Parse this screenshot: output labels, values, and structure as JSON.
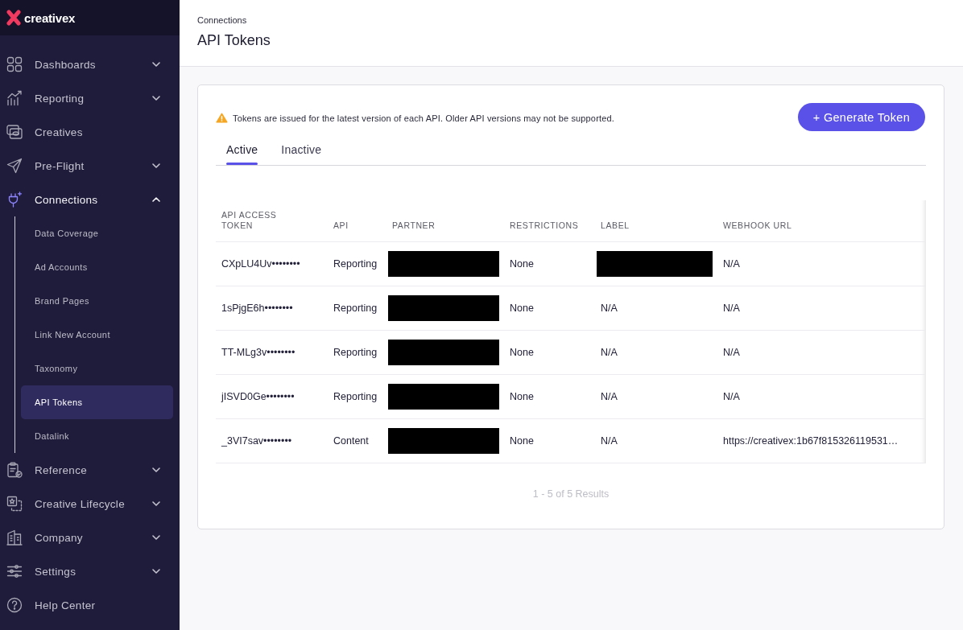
{
  "sidebar": {
    "logo": "creativex",
    "items": [
      {
        "label": "Dashboards",
        "selected": false,
        "expanded": false
      },
      {
        "label": "Reporting",
        "selected": false,
        "expanded": false
      },
      {
        "label": "Creatives",
        "selected": false
      },
      {
        "label": "Pre-Flight",
        "selected": false,
        "expanded": false
      },
      {
        "label": "Connections",
        "selected": true,
        "expanded": true,
        "children": [
          {
            "label": "Data Coverage",
            "selected": false
          },
          {
            "label": "Ad Accounts",
            "selected": false
          },
          {
            "label": "Brand Pages",
            "selected": false
          },
          {
            "label": "Link New Account",
            "selected": false
          },
          {
            "label": "Taxonomy",
            "selected": false
          },
          {
            "label": "API Tokens",
            "selected": true
          },
          {
            "label": "Datalink",
            "selected": false
          }
        ]
      },
      {
        "label": "Reference",
        "selected": false,
        "expanded": false
      },
      {
        "label": "Creative Lifecycle",
        "selected": false,
        "expanded": false
      },
      {
        "label": "Company",
        "selected": false,
        "expanded": false
      },
      {
        "label": "Settings",
        "selected": false,
        "expanded": false
      },
      {
        "label": "Help Center",
        "selected": false
      }
    ]
  },
  "header": {
    "breadcrumb": "Connections",
    "title": "API Tokens"
  },
  "notice": "Tokens are issued for the latest version of each API. Older API versions may not be supported.",
  "generate_button": "+ Generate Token",
  "tabs": [
    {
      "label": "Active",
      "selected": true
    },
    {
      "label": "Inactive",
      "selected": false
    }
  ],
  "table": {
    "columns": [
      "API ACCESS TOKEN",
      "API",
      "PARTNER",
      "RESTRICTIONS",
      "LABEL",
      "WEBHOOK URL"
    ],
    "rows": [
      {
        "cells": [
          {
            "kind": "text",
            "text": "CXpLU4Uv••••••••"
          },
          {
            "kind": "text",
            "text": "Reporting"
          },
          {
            "kind": "redacted"
          },
          {
            "kind": "text",
            "text": "None"
          },
          {
            "kind": "redacted"
          },
          {
            "kind": "text",
            "text": "N/A"
          }
        ]
      },
      {
        "cells": [
          {
            "kind": "text",
            "text": "1sPjgE6h••••••••"
          },
          {
            "kind": "text",
            "text": "Reporting"
          },
          {
            "kind": "redacted"
          },
          {
            "kind": "text",
            "text": "None"
          },
          {
            "kind": "text",
            "text": "N/A"
          },
          {
            "kind": "text",
            "text": "N/A"
          }
        ]
      },
      {
        "cells": [
          {
            "kind": "text",
            "text": "TT-MLg3v••••••••"
          },
          {
            "kind": "text",
            "text": "Reporting"
          },
          {
            "kind": "redacted"
          },
          {
            "kind": "text",
            "text": "None"
          },
          {
            "kind": "text",
            "text": "N/A"
          },
          {
            "kind": "text",
            "text": "N/A"
          }
        ]
      },
      {
        "cells": [
          {
            "kind": "text",
            "text": "jISVD0Ge••••••••"
          },
          {
            "kind": "text",
            "text": "Reporting"
          },
          {
            "kind": "redacted"
          },
          {
            "kind": "text",
            "text": "None"
          },
          {
            "kind": "text",
            "text": "N/A"
          },
          {
            "kind": "text",
            "text": "N/A"
          }
        ]
      },
      {
        "cells": [
          {
            "kind": "text",
            "text": "_3VI7sav••••••••"
          },
          {
            "kind": "text",
            "text": "Content"
          },
          {
            "kind": "redacted"
          },
          {
            "kind": "text",
            "text": "None"
          },
          {
            "kind": "text",
            "text": "N/A"
          },
          {
            "kind": "text",
            "text": "https://creativex:1b67f815326119531…"
          }
        ]
      }
    ]
  },
  "pagination": "1 - 5 of 5 Results"
}
